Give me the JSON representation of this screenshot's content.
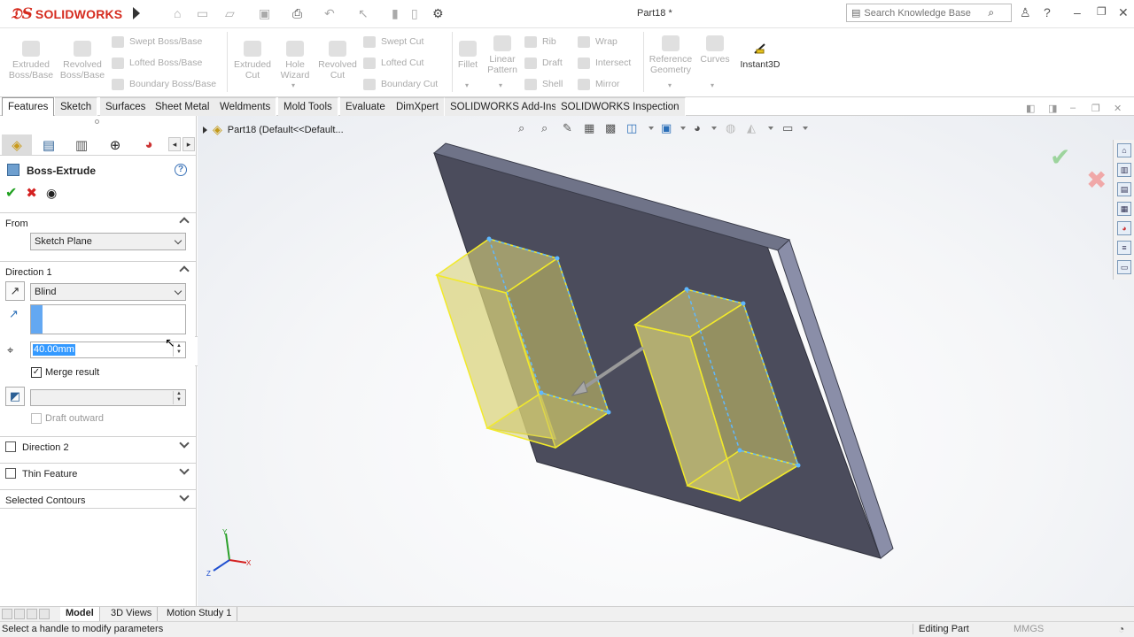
{
  "app": {
    "logo": "SOLIDWORKS",
    "document_title": "Part18 *"
  },
  "search": {
    "placeholder": "Search Knowledge Base"
  },
  "ribbon": {
    "extruded_boss": "Extruded Boss/Base",
    "revolved_boss": "Revolved Boss/Base",
    "swept_boss": "Swept Boss/Base",
    "lofted_boss": "Lofted Boss/Base",
    "boundary_boss": "Boundary Boss/Base",
    "extruded_cut": "Extruded Cut",
    "hole_wizard": "Hole Wizard",
    "revolved_cut": "Revolved Cut",
    "swept_cut": "Swept Cut",
    "lofted_cut": "Lofted Cut",
    "boundary_cut": "Boundary Cut",
    "fillet": "Fillet",
    "linear_pattern": "Linear Pattern",
    "rib": "Rib",
    "draft": "Draft",
    "shell": "Shell",
    "wrap": "Wrap",
    "intersect": "Intersect",
    "mirror": "Mirror",
    "reference_geometry": "Reference Geometry",
    "curves": "Curves",
    "instant3d": "Instant3D"
  },
  "command_tabs": [
    "Features",
    "Sketch",
    "Surfaces",
    "Sheet Metal",
    "Weldments",
    "Mold Tools",
    "Evaluate",
    "DimXpert",
    "SOLIDWORKS Add-Ins",
    "SOLIDWORKS Inspection"
  ],
  "property_manager": {
    "title": "Boss-Extrude",
    "from_label": "From",
    "from_value": "Sketch Plane",
    "direction1_label": "Direction 1",
    "end_condition": "Blind",
    "depth": "40.00mm",
    "merge_result": "Merge result",
    "draft_outward": "Draft outward",
    "direction2_label": "Direction 2",
    "thin_feature_label": "Thin Feature",
    "selected_contours_label": "Selected Contours"
  },
  "viewport": {
    "tree_flyout": "Part18  (Default<<Default..."
  },
  "bottom_tabs": [
    "Model",
    "3D Views",
    "Motion Study 1"
  ],
  "status": {
    "message": "Select a handle to modify parameters",
    "mode": "Editing Part",
    "units": "MMGS"
  },
  "colors": {
    "brand": "#d52b1e",
    "plate": "#4b4c5c",
    "plate_edge": "#8a8ea8",
    "preview_fill": "#d9d27a",
    "preview_edge": "#f2ea2a",
    "ok": "#21a121",
    "cancel": "#d42020"
  }
}
